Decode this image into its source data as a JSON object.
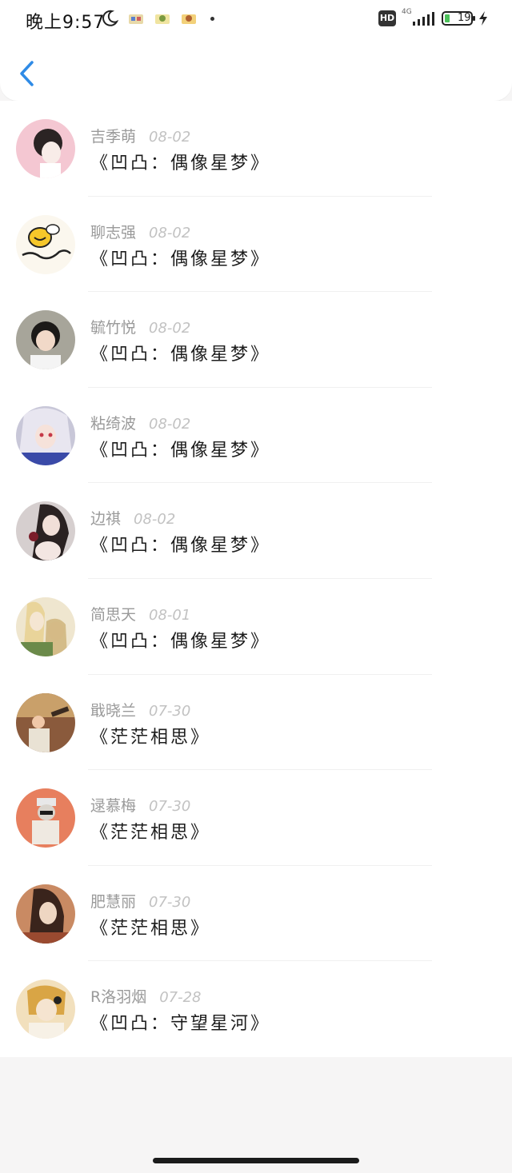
{
  "status_bar": {
    "time": "晚上9:57",
    "network": "4G",
    "battery": "19"
  },
  "header": {
    "back_icon": "chevron-left-icon"
  },
  "items": [
    {
      "name": "吉季萌",
      "date": "08-02",
      "title": "《凹凸：偶像星梦》",
      "avatar_bg": "#f4c7d2"
    },
    {
      "name": "聊志强",
      "date": "08-02",
      "title": "《凹凸：偶像星梦》",
      "avatar_bg": "#fbf7ee"
    },
    {
      "name": "毓竹悦",
      "date": "08-02",
      "title": "《凹凸：偶像星梦》",
      "avatar_bg": "#a7a59a"
    },
    {
      "name": "粘绮波",
      "date": "08-02",
      "title": "《凹凸：偶像星梦》",
      "avatar_bg": "#c8c7d8"
    },
    {
      "name": "边祺",
      "date": "08-02",
      "title": "《凹凸：偶像星梦》",
      "avatar_bg": "#d6cfcf"
    },
    {
      "name": "简思天",
      "date": "08-01",
      "title": "《凹凸：偶像星梦》",
      "avatar_bg": "#efe6cf"
    },
    {
      "name": "戢晓兰",
      "date": "07-30",
      "title": "《茫茫相思》",
      "avatar_bg": "#8a5a3c"
    },
    {
      "name": "逯慕梅",
      "date": "07-30",
      "title": "《茫茫相思》",
      "avatar_bg": "#e77f5e"
    },
    {
      "name": "肥慧丽",
      "date": "07-30",
      "title": "《茫茫相思》",
      "avatar_bg": "#c98a63"
    },
    {
      "name": "R洛羽烟",
      "date": "07-28",
      "title": "《凹凸：守望星河》",
      "avatar_bg": "#f2e0bd"
    }
  ]
}
